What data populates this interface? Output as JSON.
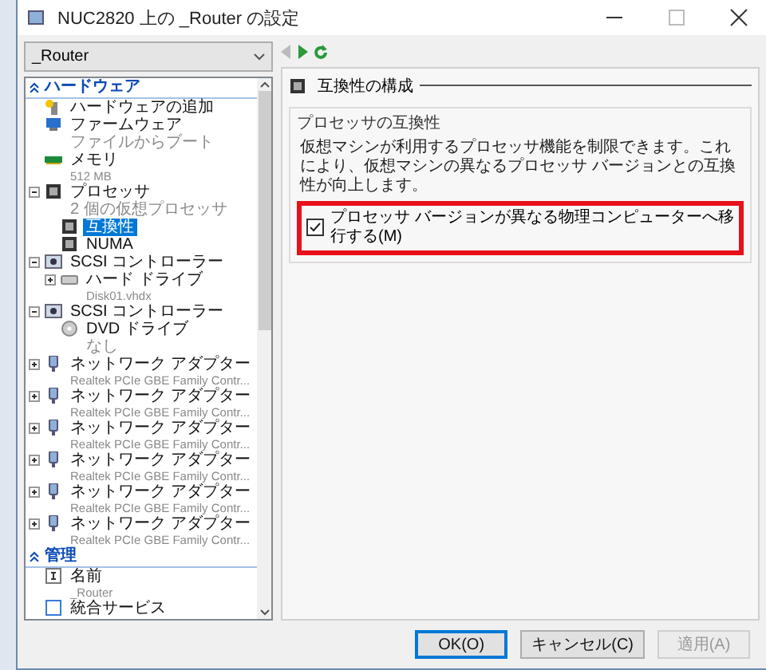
{
  "window": {
    "title": "NUC2820 上の _Router の設定"
  },
  "vm_selector": {
    "value": "_Router"
  },
  "tree": {
    "sections": [
      {
        "label": "ハードウェア",
        "expanded": true,
        "items": [
          {
            "kind": "add",
            "label": "ハードウェアの追加",
            "selected": false
          },
          {
            "kind": "firmware",
            "label": "ファームウェア",
            "detail": "ファイルからブート",
            "selected": false
          },
          {
            "kind": "memory",
            "label": "メモリ",
            "detail": "512 MB",
            "selected": false
          },
          {
            "kind": "processor",
            "label": "プロセッサ",
            "detail": "2 個の仮想プロセッサ",
            "selected": false,
            "expanded": true,
            "children": [
              {
                "kind": "chip",
                "label": "互換性",
                "selected": true
              },
              {
                "kind": "chip",
                "label": "NUMA",
                "selected": false
              }
            ]
          },
          {
            "kind": "scsi",
            "label": "SCSI コントローラー",
            "selected": false,
            "expanded": true,
            "children": [
              {
                "kind": "disk",
                "label": "ハード ドライブ",
                "detail": "Disk01.vhdx",
                "selected": false,
                "expanded": false
              }
            ]
          },
          {
            "kind": "scsi",
            "label": "SCSI コントローラー",
            "selected": false,
            "expanded": true,
            "children": [
              {
                "kind": "dvd",
                "label": "DVD ドライブ",
                "detail": "なし",
                "selected": false
              }
            ]
          },
          {
            "kind": "network",
            "label": "ネットワーク アダプター",
            "detail": "Realtek PCIe GBE Family Contr...",
            "selected": false,
            "expanded": false
          },
          {
            "kind": "network",
            "label": "ネットワーク アダプター",
            "detail": "Realtek PCIe GBE Family Contr...",
            "selected": false,
            "expanded": false
          },
          {
            "kind": "network",
            "label": "ネットワーク アダプター",
            "detail": "Realtek PCIe GBE Family Contr...",
            "selected": false,
            "expanded": false
          },
          {
            "kind": "network",
            "label": "ネットワーク アダプター",
            "detail": "Realtek PCIe GBE Family Contr...",
            "selected": false,
            "expanded": false
          },
          {
            "kind": "network",
            "label": "ネットワーク アダプター",
            "detail": "Realtek PCIe GBE Family Contr...",
            "selected": false,
            "expanded": false
          },
          {
            "kind": "network",
            "label": "ネットワーク アダプター",
            "detail": "Realtek PCIe GBE Family Contr...",
            "selected": false,
            "expanded": false
          }
        ]
      },
      {
        "label": "管理",
        "expanded": true,
        "items": [
          {
            "kind": "name",
            "label": "名前",
            "detail": "_Router",
            "selected": false
          },
          {
            "kind": "integration",
            "label": "統合サービス",
            "selected": false
          }
        ]
      }
    ]
  },
  "panel": {
    "title": "互換性の構成",
    "group": {
      "title": "プロセッサの互換性",
      "description": "仮想マシンが利用するプロセッサ機能を制限できます。これにより、仮想マシンの異なるプロセッサ バージョンとの互換性が向上します。",
      "option": {
        "label": "プロセッサ バージョンが異なる物理コンピューターへ移行する(M)",
        "checked": true,
        "highlighted": true
      }
    }
  },
  "buttons": [
    {
      "label": "OK(O)",
      "default": true,
      "disabled": false
    },
    {
      "label": "キャンセル(C)",
      "default": false,
      "disabled": false
    },
    {
      "label": "適用(A)",
      "default": false,
      "disabled": true
    }
  ]
}
